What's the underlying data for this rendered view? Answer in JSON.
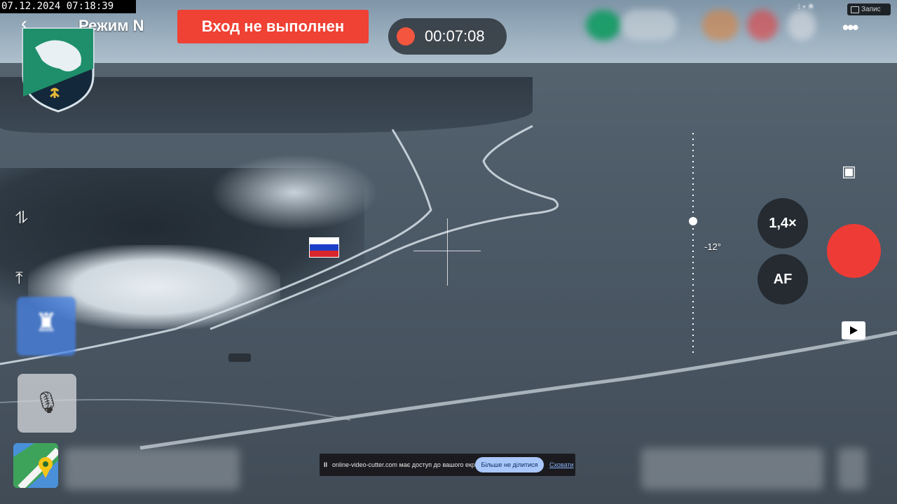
{
  "overlay": {
    "timestamp": "07.12.2024 07:18:39",
    "mode_label": "Режим N",
    "login_status": "Вход не выполнен",
    "recording_time": "00:07:08",
    "rec_chip": "Запис"
  },
  "camera": {
    "zoom_label": "1,4×",
    "af_label": "AF",
    "tilt_label": "-12°"
  },
  "share_bar": {
    "message": "online-video-cutter.com має доступ до вашого екрана.",
    "stop_label": "Більше не ділитися",
    "hide_label": "Сховати"
  },
  "colors": {
    "accent_red": "#ef4134",
    "record_dot": "#f3553e",
    "shutter": "#ef3b36",
    "emblem_green": "#1e8f6a",
    "emblem_dark": "#13283a"
  },
  "icons": {
    "back": "back-arrow-icon",
    "more": "more-dots-icon",
    "gallery": "gallery-icon",
    "play": "play-icon",
    "microphone_muted": "mic-off-icon",
    "map": "map-icon",
    "castle": "castle-icon",
    "return_home": "return-home-icon",
    "gimbal": "gimbal-icon",
    "flag": "russian-flag-icon"
  }
}
